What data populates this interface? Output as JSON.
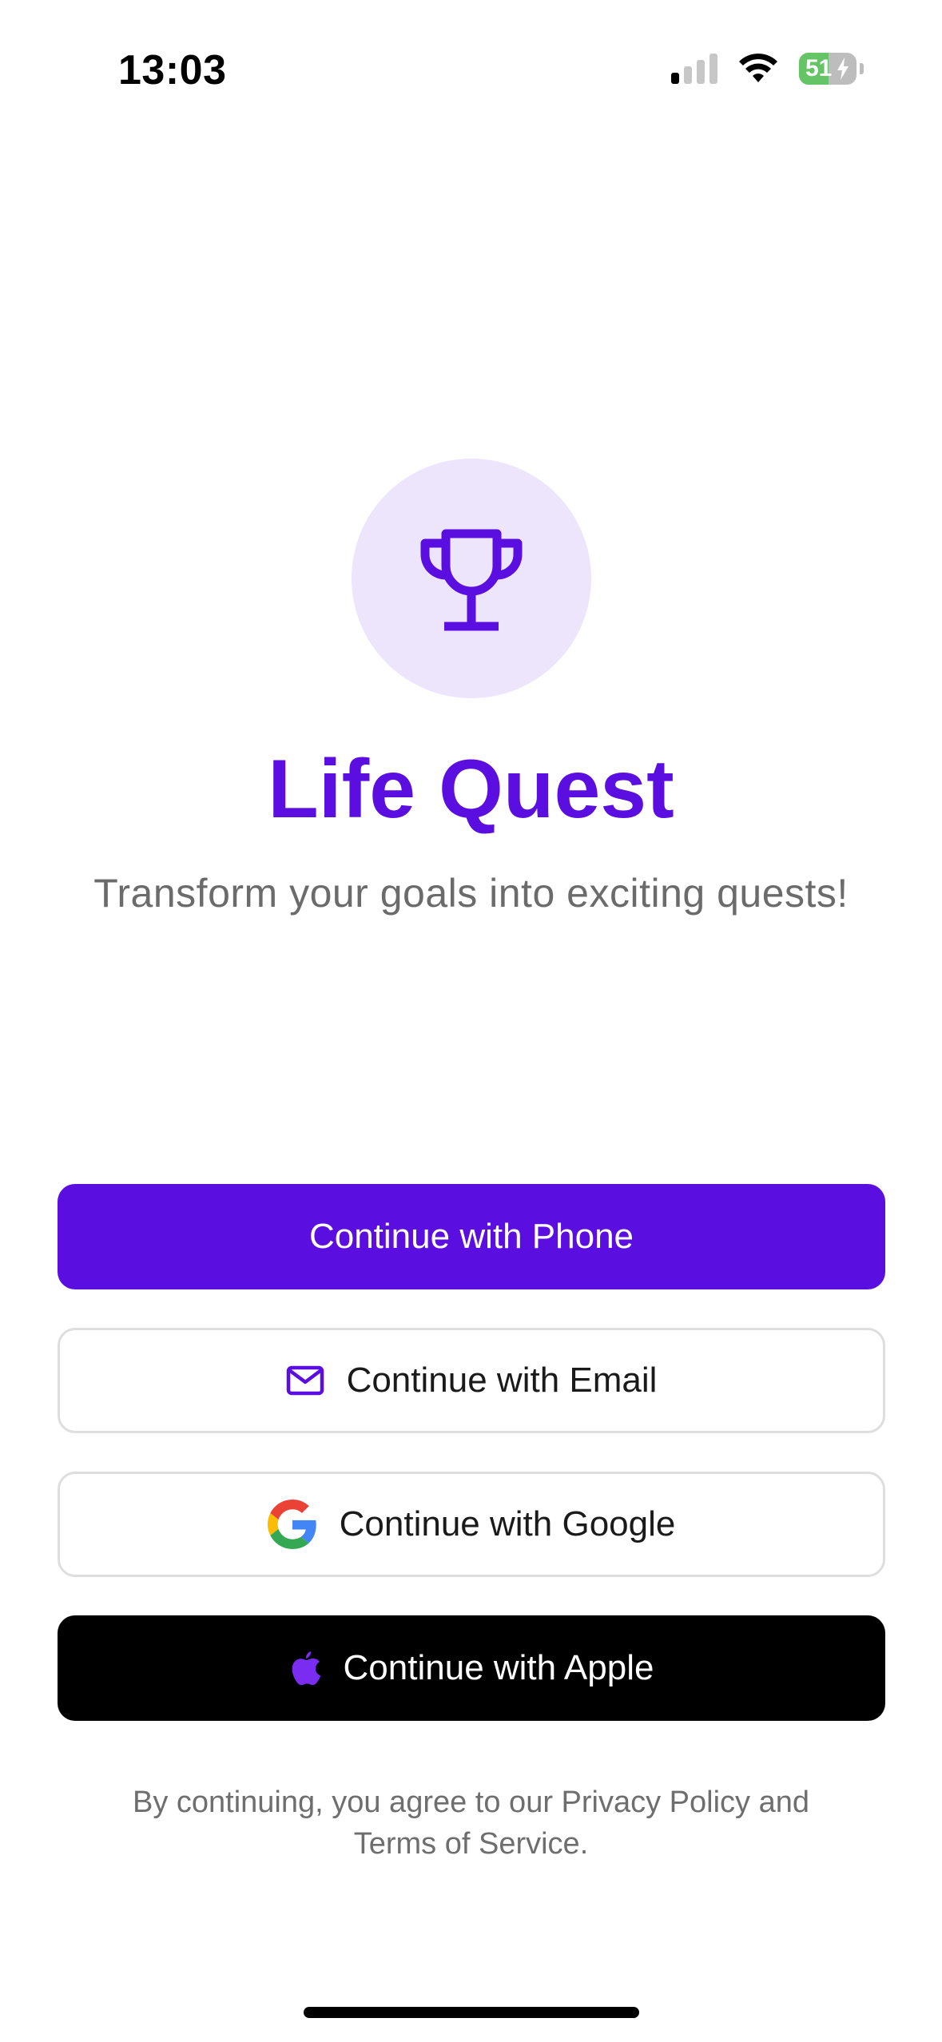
{
  "status_bar": {
    "time": "13:03",
    "battery_percent": "51",
    "battery_level": 0.51,
    "signal_bars_active": 1,
    "signal_bars_total": 4,
    "charging": true,
    "icons": [
      "cellular-signal-icon",
      "wifi-icon",
      "battery-charging-icon"
    ]
  },
  "hero": {
    "logo_icon": "trophy-icon",
    "title": "Life Quest",
    "tagline": "Transform your goals into exciting quests!"
  },
  "auth": {
    "phone": {
      "label": "Continue with Phone"
    },
    "email": {
      "label": "Continue with Email",
      "icon": "mail-icon"
    },
    "google": {
      "label": "Continue with Google",
      "icon": "google-logo-icon"
    },
    "apple": {
      "label": "Continue with Apple",
      "icon": "apple-logo-icon"
    }
  },
  "legal": {
    "prefix": "By continuing, you agree to our ",
    "privacy_link": "Privacy Policy",
    "connector": " and",
    "terms_link": "Terms of Service",
    "suffix": "."
  },
  "colors": {
    "brand": "#5b0ee0",
    "logo_bg": "#ede5fc",
    "apple_button": "#000000",
    "border": "#dedede",
    "battery_green": "#65c466"
  }
}
